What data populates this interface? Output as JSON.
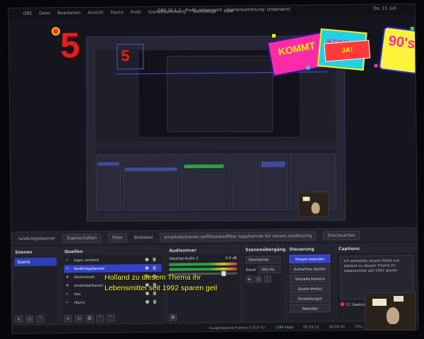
{
  "window": {
    "title": "OBS 30.1.2 - Profil: Unbenannt - Szenensammlung: Unbenannt",
    "clock": "Do. 11. Juli"
  },
  "menubar": {
    "items": [
      "OBS",
      "Datei",
      "Bearbeiten",
      "Ansicht",
      "Docks",
      "Profil",
      "Szenensammlung",
      "Werkzeuge",
      "Hilfe"
    ]
  },
  "overlay": {
    "big_number": "5",
    "sticker_kommt": "KOMMT",
    "sticker_ja": "JA!",
    "sticker_kommt_2": "KOMMT",
    "sticker_90": "90's"
  },
  "dock_header": {
    "source_name": "landkriegsbanner",
    "properties_label": "Eigenschaften",
    "filter_label": "Filter",
    "file_label": "Bilddatei",
    "file_path": "emerkleerbanen.sofifilterlandfilter logo/banner für sonam.nordboying",
    "browse_label": "Durchsuchen"
  },
  "scenes": {
    "title": "Szenen",
    "items": [
      "Szene"
    ]
  },
  "sources": {
    "title": "Quellen",
    "items": [
      {
        "label": "logos verdient",
        "selected": false
      },
      {
        "label": "landkriegsbanner",
        "selected": true
      },
      {
        "label": "Klemmbrett",
        "selected": false
      },
      {
        "label": "emerkleerbanen",
        "selected": false
      },
      {
        "label": "Hex",
        "selected": false
      },
      {
        "label": "Marns",
        "selected": false
      }
    ]
  },
  "mixer": {
    "title": "Audiomixer",
    "channel_name": "Desktop-Audio 2",
    "channel_db": "0.0 dB"
  },
  "transitions": {
    "title": "Szenenübergänge",
    "type": "Überblende",
    "duration_label": "Dauer",
    "duration_value": "300 ms"
  },
  "controls": {
    "title": "Steuerung",
    "buttons": [
      "Stream beenden",
      "Aufnahme starten",
      "Virtuelle Kamera",
      "Studio-Modus",
      "Einstellungen",
      "Beenden"
    ]
  },
  "captions": {
    "title": "Captions",
    "text": "Ich verstellen unsere Gäste aus Holland zu diesem Thema ihr Lebensmittel seit 1992 sparen",
    "source": "CC Desktop-Audio"
  },
  "statusbar": {
    "dropped": "Ausgelassene Frames 0 (0,0 %)",
    "kbps": "1284 kbps",
    "live_time": "00:59:53",
    "rec_time": "00:00:00",
    "cpu": "CPU: 34.4%"
  },
  "subtitle": {
    "text": "Holland zu diesem Thema ihr Lebensmittel seit 1992 sparen geil"
  }
}
